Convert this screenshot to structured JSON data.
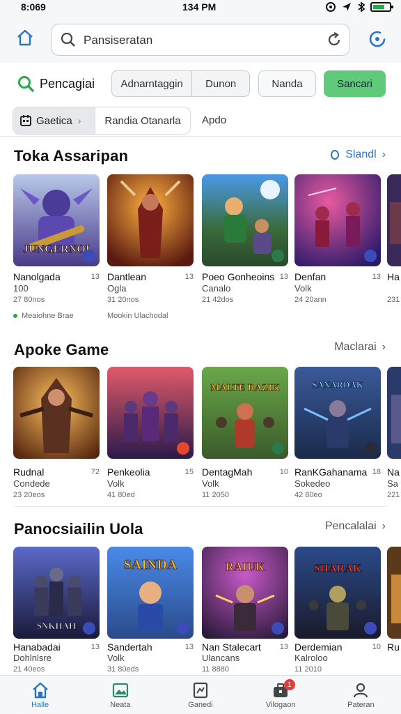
{
  "status_bar": {
    "time_left": "8:069",
    "time_center": "134 PM"
  },
  "browser": {
    "url": "Pansiseratan"
  },
  "search_row": {
    "brand_label": "Pencagiai",
    "segments": [
      "Adnarntaggin",
      "Dunon"
    ],
    "outline_button": "Nanda",
    "primary_button": "Sancari"
  },
  "filters": {
    "active_chip": "Gaetica",
    "second_chip": "Randia Otanarla",
    "text_chip": "Apdo"
  },
  "sections": [
    {
      "title": "Toka Assaripan",
      "link": "Slandl",
      "cards": [
        {
          "name": "Nanolgada",
          "num": "13",
          "sub": "100",
          "meta": "27 80nos",
          "art": "JUNGERNOI"
        },
        {
          "name": "Dantlean",
          "num": "13",
          "sub": "Ogla",
          "meta": "31 20nos",
          "art": ""
        },
        {
          "name": "Poeo Gonheoins",
          "num": "13",
          "sub": "Canalo",
          "meta": "21 42dos",
          "art": ""
        },
        {
          "name": "Denfan",
          "num": "13",
          "sub": "Volk",
          "meta": "24 20ann",
          "art": ""
        },
        {
          "name": "Ha",
          "num": "",
          "sub": "",
          "meta": "231",
          "art": ""
        }
      ],
      "taglines": [
        "Meaiohne Brae",
        "Mookin Ulachodal"
      ]
    },
    {
      "title": "Apoke Game",
      "link": "Maclarai",
      "cards": [
        {
          "name": "Rudnal",
          "num": "72",
          "sub": "Condede",
          "meta": "23 20eos",
          "art": ""
        },
        {
          "name": "Penkeolia",
          "num": "15",
          "sub": "Volk",
          "meta": "41 80ed",
          "art": ""
        },
        {
          "name": "DentagMah",
          "num": "10",
          "sub": "Volk",
          "meta": "11 2050",
          "art": "MALTE RAZIK"
        },
        {
          "name": "RanKGahanama",
          "num": "18",
          "sub": "Sokedeo",
          "meta": "42 80eo",
          "art": "SANARDAK"
        },
        {
          "name": "Na",
          "num": "",
          "sub": "Sa",
          "meta": "221",
          "art": ""
        }
      ]
    },
    {
      "title": "Panocsiailin Uola",
      "link": "Pencalalai",
      "cards": [
        {
          "name": "Hanabadai",
          "num": "13",
          "sub": "Dohlnlsre",
          "meta": "21 40eos",
          "art": "SNKHAH"
        },
        {
          "name": "Sandertah",
          "num": "13",
          "sub": "Volk",
          "meta": "31 80eds",
          "art": "SAINDA"
        },
        {
          "name": "Nan Stalecart",
          "num": "13",
          "sub": "Ulancans",
          "meta": "11 8880",
          "art": "RAIUK"
        },
        {
          "name": "Derdemian",
          "num": "10",
          "sub": "Kalroloo",
          "meta": "11 2010",
          "art": "SHARAK"
        },
        {
          "name": "Ru",
          "num": "",
          "sub": "",
          "meta": "",
          "art": ""
        }
      ]
    }
  ],
  "bottom_nav": [
    {
      "label": "Halle",
      "icon": "home-icon"
    },
    {
      "label": "Neata",
      "icon": "image-icon"
    },
    {
      "label": "Ganedi",
      "icon": "document-icon"
    },
    {
      "label": "Vilogaon",
      "icon": "briefcase-icon",
      "badge": "1"
    },
    {
      "label": "Pateran",
      "icon": "profile-icon"
    }
  ],
  "colors": {
    "accent": "#2874c8",
    "primary_button": "#5fcb7a",
    "badge": "#e23b3b"
  }
}
